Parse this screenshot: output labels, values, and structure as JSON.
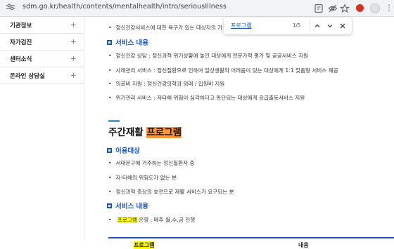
{
  "browser": {
    "url": "sdm.go.kr/health/contents/mentalhealth/intro/seriousIllness"
  },
  "sidebar": {
    "items": [
      {
        "label": "기관정보",
        "expander": "+"
      },
      {
        "label": "자가검진",
        "expander": "+"
      },
      {
        "label": "센터소식",
        "expander": "+"
      },
      {
        "label": "온라인 상담실",
        "expander": "+"
      }
    ]
  },
  "findbar": {
    "query": "프로그램",
    "count": "1/5"
  },
  "content": {
    "top_bullet": "정신건강서비스에 대한 욕구가 있는 대상자의 가",
    "service_head_1": "서비스 내용",
    "service_items_1": [
      "정신건강 상담 : 정신과적 위기상황에 놓인 대상에게 전문가적 평가 및 공공서비스 지원",
      "사례관리 서비스 : 정신질환으로 인하여 일상생활의 어려움이 있는 대상에게 1:1 맞춤형 서비스 제공",
      "의료비 지원 : 정신건강의학과 외래 / 입원비 지원",
      "위기관리 서비스 : 자타해 위험이 심각하다고 판단되는 대상에게 응급출동서비스 지원"
    ],
    "title_prefix": "주간재활 ",
    "title_highlight": "프로그램",
    "target_head": "이용대상",
    "target_items": [
      "서대문구에 거주하는 정신질환자 중",
      "자·타해의 위험도가 없는 분",
      "정신과적 증상의 호전으로 재활 서비스가 요구되는 분"
    ],
    "service_head_2": "서비스 내용",
    "program_highlight": "프로그램",
    "program_rest": " 운영 : 매주 월,수,금 진행",
    "table_headers": [
      "프로그램",
      "내용"
    ]
  }
}
